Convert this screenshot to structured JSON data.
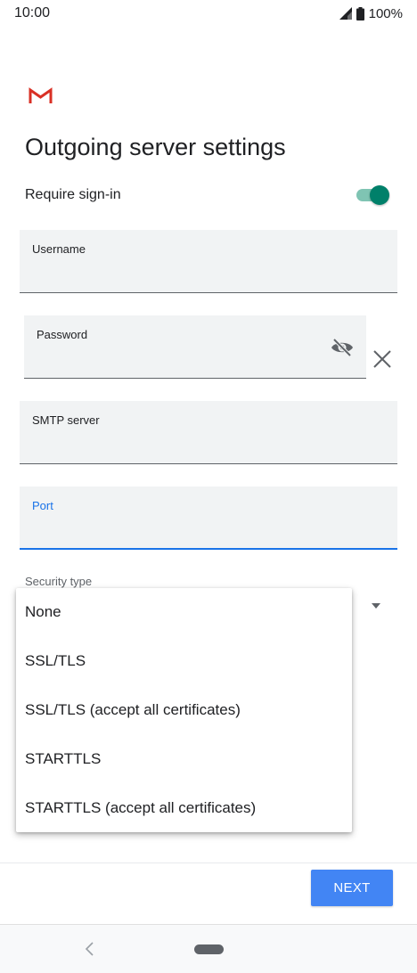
{
  "status_bar": {
    "time": "10:00",
    "battery_percent": "100%",
    "icons": [
      "signal-icon",
      "battery-icon"
    ]
  },
  "app": {
    "logo": "gmail-logo",
    "accent_color": "#1a73e8",
    "toggle_color": "#00806a"
  },
  "page": {
    "title": "Outgoing server settings",
    "require_signin": {
      "label": "Require sign-in",
      "enabled": true
    }
  },
  "fields": {
    "username": {
      "label": "Username",
      "value": ""
    },
    "password": {
      "label": "Password",
      "value": ""
    },
    "smtp_server": {
      "label": "SMTP server",
      "value": ""
    },
    "port": {
      "label": "Port",
      "value": "",
      "focused": true
    }
  },
  "security": {
    "label": "Security type",
    "options": [
      "None",
      "SSL/TLS",
      "SSL/TLS (accept all certificates)",
      "STARTTLS",
      "STARTTLS (accept all certificates)"
    ]
  },
  "actions": {
    "next_label": "NEXT",
    "next_color": "#4285f4"
  },
  "navigation": {
    "icons": [
      "back-icon",
      "home-pill"
    ]
  }
}
